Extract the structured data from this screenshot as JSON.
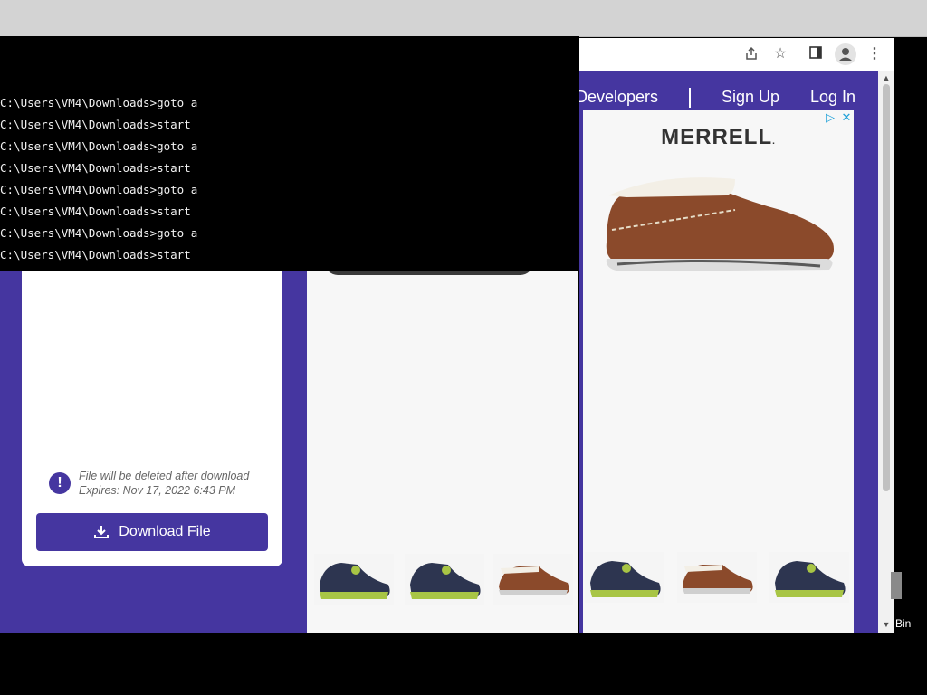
{
  "cmd": {
    "lines": [
      "C:\\Users\\VM4\\Downloads>goto a",
      "C:\\Users\\VM4\\Downloads>start",
      "C:\\Users\\VM4\\Downloads>goto a",
      "C:\\Users\\VM4\\Downloads>start",
      "C:\\Users\\VM4\\Downloads>goto a",
      "C:\\Users\\VM4\\Downloads>start",
      "C:\\Users\\VM4\\Downloads>goto a",
      "C:\\Users\\VM4\\Downloads>start"
    ]
  },
  "site": {
    "nav": {
      "developers": "Developers",
      "signup": "Sign Up",
      "login": "Log In"
    },
    "ad": {
      "brand": "MERRELL",
      "brand_dot": "."
    },
    "notice": {
      "line1": "File will be deleted after download",
      "line2": "Expires: Nov 17, 2022 6:43 PM"
    },
    "download_label": "Download File"
  },
  "desktop": {
    "bin_label": "Bin"
  },
  "colors": {
    "brand": "#4536a0"
  }
}
